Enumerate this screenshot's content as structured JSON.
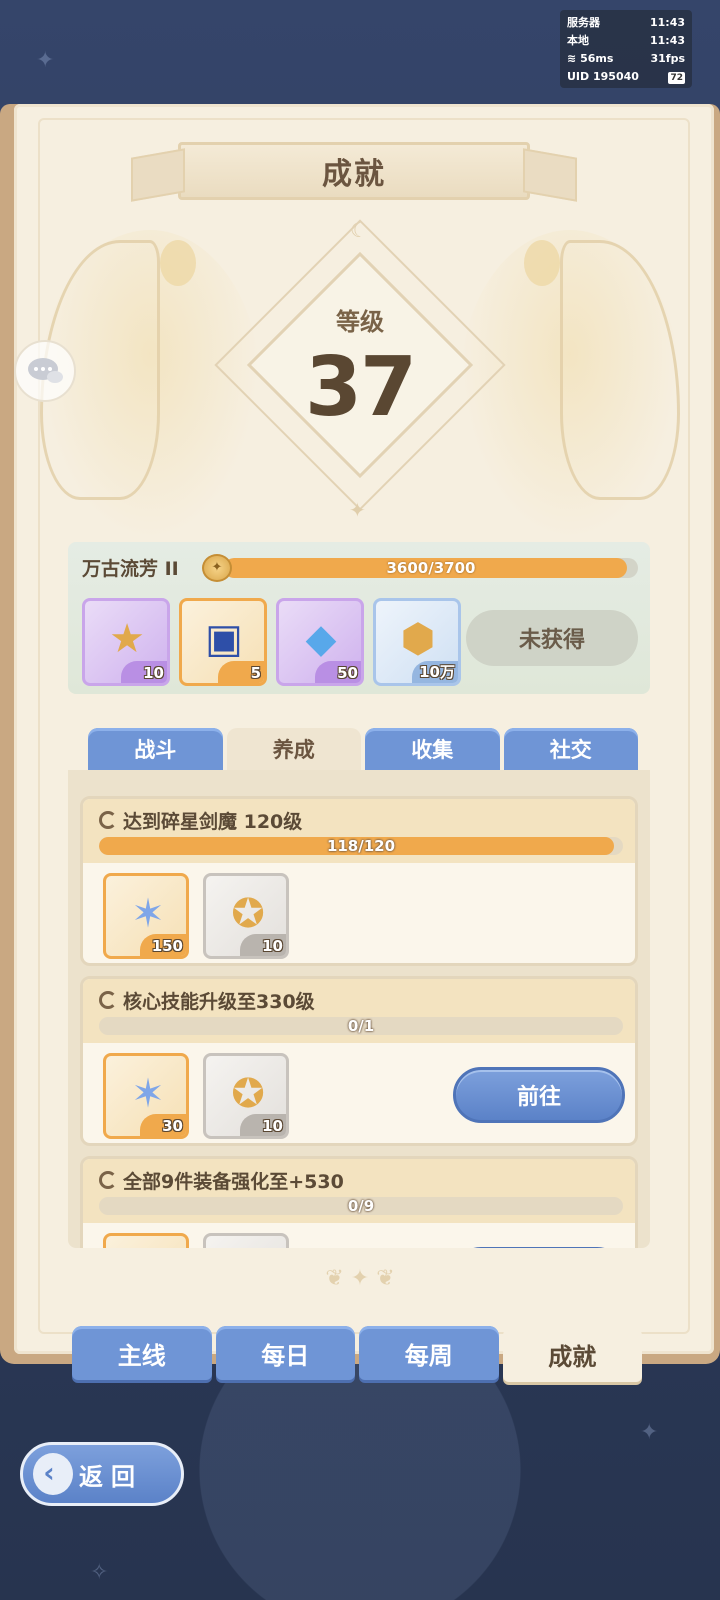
{
  "status": {
    "server_label": "服务器",
    "server_time": "11:43",
    "local_label": "本地",
    "local_time": "11:43",
    "ping": "56ms",
    "fps": "31fps",
    "uid": "UID 195040",
    "battery": "72"
  },
  "page": {
    "title": "成就",
    "level_label": "等级",
    "level_value": "37"
  },
  "rank": {
    "name": "万古流芳 II",
    "xp_text": "3600/3700",
    "xp_progress": 0.973,
    "rewards": [
      {
        "icon": "gold-star-icon",
        "count": "10",
        "rarity": "purple"
      },
      {
        "icon": "eye-card-icon",
        "count": "5",
        "rarity": "orange"
      },
      {
        "icon": "blue-crystal-icon",
        "count": "50",
        "rarity": "purple"
      },
      {
        "icon": "gold-coin-icon",
        "count": "10万",
        "rarity": "blue"
      }
    ],
    "status_button": "未获得"
  },
  "category_tabs": [
    {
      "label": "战斗",
      "active": false
    },
    {
      "label": "养成",
      "active": true
    },
    {
      "label": "收集",
      "active": false
    },
    {
      "label": "社交",
      "active": false
    }
  ],
  "tasks": [
    {
      "title": "达到碎星剑魔  120级",
      "progress_text": "118/120",
      "progress": 0.983,
      "rewards": [
        {
          "icon": "blue-star-crystal-icon",
          "count": "150",
          "rarity": "orange"
        },
        {
          "icon": "winged-coin-icon",
          "count": "10",
          "rarity": "gray"
        }
      ],
      "button": ""
    },
    {
      "title": "核心技能升级至330级",
      "progress_text": "0/1",
      "progress": 0,
      "rewards": [
        {
          "icon": "blue-star-crystal-icon",
          "count": "30",
          "rarity": "orange"
        },
        {
          "icon": "winged-coin-icon",
          "count": "10",
          "rarity": "gray"
        }
      ],
      "button": "前往"
    },
    {
      "title": "全部9件装备强化至+530",
      "progress_text": "0/9",
      "progress": 0,
      "rewards": [],
      "button": ""
    }
  ],
  "main_tabs": [
    {
      "label": "主线",
      "active": false
    },
    {
      "label": "每日",
      "active": false
    },
    {
      "label": "每周",
      "active": false
    },
    {
      "label": "成就",
      "active": true
    }
  ],
  "back_button": "返回"
}
